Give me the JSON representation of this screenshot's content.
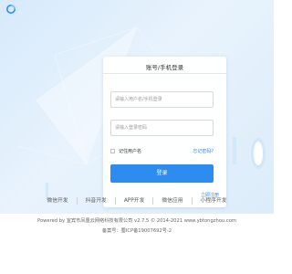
{
  "login": {
    "title": "账号/手机登录",
    "username_placeholder": "请输入用户名/手机登录",
    "password_placeholder": "请输入登录密码",
    "remember_label": "记住用户名",
    "forgot_label": "忘记密码?",
    "login_button": "登录",
    "register_label": "立即注册"
  },
  "nav": {
    "items": [
      "微信开发",
      "抖音开发",
      "APP开发",
      "微信应用",
      "小程序开发"
    ]
  },
  "footer": {
    "copyright": "Powered by 宜宾市凤凰云网络科技有限公司 v2.7.5 © 2014-2021 www.ybtongzhou.com",
    "icp": "备案号：蜀ICP备19007692号-2"
  },
  "colors": {
    "accent": "#2d8cf0",
    "hero_bg": "#dcecfa"
  },
  "icons": {
    "logo": "app-logo-icon"
  }
}
